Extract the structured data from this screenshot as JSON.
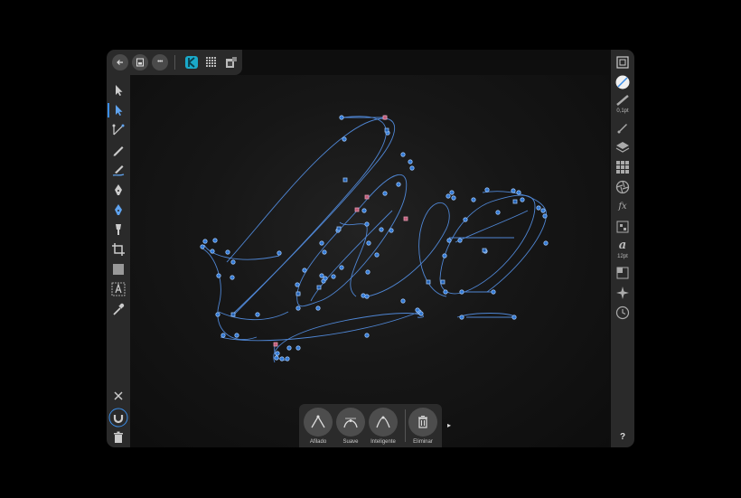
{
  "app": {
    "name": "Vector editor"
  },
  "topbar": {
    "back_icon": "back-arrow-icon",
    "doc_icon": "document-icon",
    "more_label": "•••",
    "persona_icons": [
      "designer-persona-icon",
      "pixel-persona-icon",
      "export-persona-icon"
    ]
  },
  "left_tools": [
    "move-tool-icon",
    "node-tool-icon",
    "corner-tool-icon",
    "pencil-tool-icon",
    "vector-brush-tool-icon",
    "pen-tool-icon",
    "fill-tool-icon",
    "transparency-tool-icon",
    "crop-tool-icon",
    "rectangle-tool-icon",
    "artistic-text-tool-icon",
    "color-picker-tool-icon"
  ],
  "left_bottom": [
    "close-icon",
    "snapping-magnet-icon",
    "trash-icon"
  ],
  "right_panel": {
    "stroke_width_label": "0,1pt",
    "font_size_label": "12pt",
    "font_glyph": "a",
    "fx_label": "fx",
    "help_label": "?"
  },
  "context_toolbar": {
    "items": [
      {
        "label": "Afilado"
      },
      {
        "label": "Suave"
      },
      {
        "label": "Inteligente"
      },
      {
        "label": "Eliminar"
      }
    ],
    "more_arrow": "▸"
  },
  "colors": {
    "accent": "#4a90e2",
    "path": "#5b8fd9",
    "node_fill": "#2f78d6",
    "selected_node": "#c05a78"
  }
}
